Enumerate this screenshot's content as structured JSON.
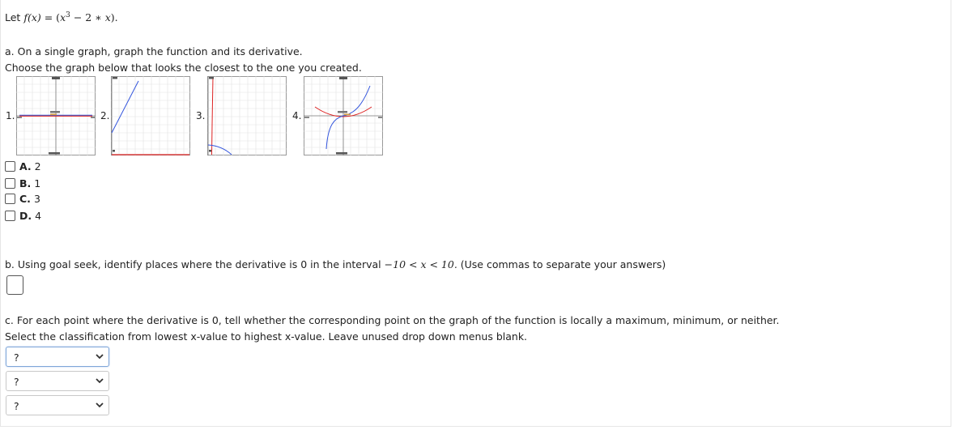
{
  "problem": {
    "prefix": "Let ",
    "fx": "f(x)",
    "eq": " = (",
    "x1": "x",
    "exp": "3",
    "rest": " − 2 ∗ ",
    "x2": "x",
    "close": ")."
  },
  "part_a": {
    "line1": "a. On a single graph, graph the function and its derivative.",
    "line2": "Choose the graph below that looks the closest to the one you created.",
    "graph_numbers": [
      "1.",
      "2.",
      "3.",
      "4."
    ],
    "options": [
      {
        "letter": "A.",
        "value": "2"
      },
      {
        "letter": "B.",
        "value": "1"
      },
      {
        "letter": "C.",
        "value": "3"
      },
      {
        "letter": "D.",
        "value": "4"
      }
    ]
  },
  "part_b": {
    "pre": "b. Using goal seek, identify places where the derivative is 0 in the interval ",
    "interval": "−10 < x < 10.",
    "post": " (Use commas to separate your answers)"
  },
  "part_c": {
    "line1": "c. For each point where the derivative is 0, tell whether the corresponding point on the graph of the function is locally a maximum, minimum, or neither.",
    "line2": "Select the classification from lowest x-value to highest x-value. Leave unused drop down menus blank.",
    "dropdowns": [
      "?",
      "?",
      "?"
    ]
  },
  "colors": {
    "function_curve": "#3355dd",
    "derivative_curve": "#dd2222",
    "grid": "#d8d8d8",
    "focus_border": "#7fa6d8"
  }
}
